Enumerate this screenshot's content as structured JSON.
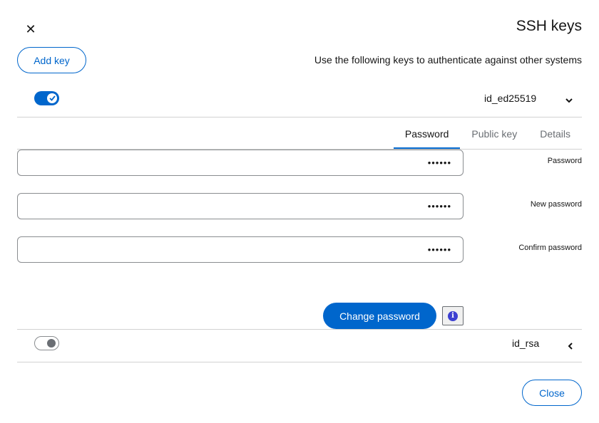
{
  "dialog": {
    "title": "SSH keys",
    "subtitle": "Use the following keys to authenticate against other systems",
    "add_key_label": "Add key",
    "close_label": "Close"
  },
  "keys": [
    {
      "name": "id_ed25519",
      "enabled": true,
      "expanded": true,
      "tabs": [
        {
          "label": "Password",
          "active": true
        },
        {
          "label": "Public key",
          "active": false
        },
        {
          "label": "Details",
          "active": false
        }
      ],
      "fields": [
        {
          "label": "Password",
          "value": "••••••"
        },
        {
          "label": "New password",
          "value": "••••••"
        },
        {
          "label": "Confirm password",
          "value": "••••••"
        }
      ],
      "change_password_label": "Change password"
    },
    {
      "name": "id_rsa",
      "enabled": false,
      "expanded": false
    }
  ],
  "colors": {
    "accent": "#0066cc",
    "border": "#d2d2d2",
    "info": "#3c3fd1"
  }
}
